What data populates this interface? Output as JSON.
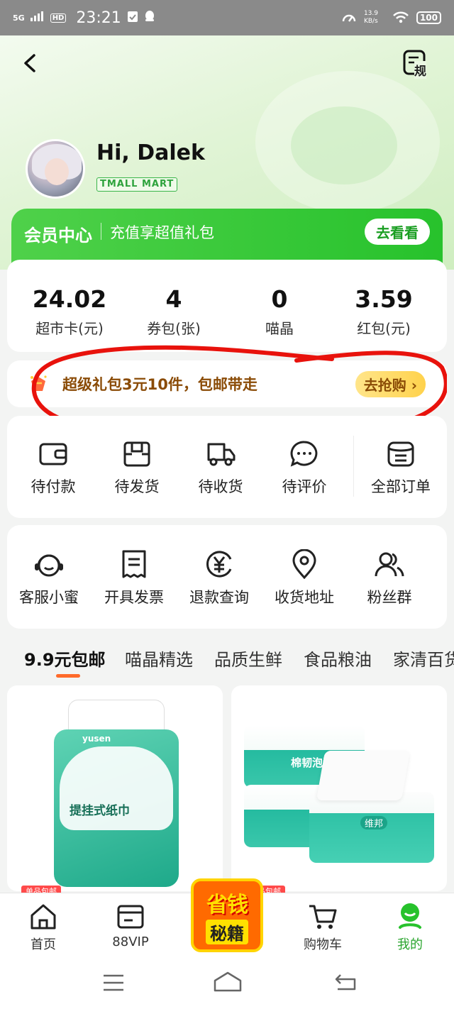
{
  "status_bar": {
    "network": "5G",
    "hd": "HD",
    "time": "23:21",
    "speed": "13.9 KB/s",
    "battery": "100"
  },
  "header": {
    "back_icon": "chevron-left-icon",
    "rules_label": "规"
  },
  "profile": {
    "greeting": "Hi, Dalek",
    "badge": "TMALL MART"
  },
  "member": {
    "title": "会员中心",
    "subtitle": "充值享超值礼包",
    "button": "去看看"
  },
  "stats": [
    {
      "value": "24.02",
      "label": "超市卡(元)"
    },
    {
      "value": "4",
      "label": "券包(张)"
    },
    {
      "value": "0",
      "label": "喵晶"
    },
    {
      "value": "3.59",
      "label": "红包(元)"
    }
  ],
  "promo": {
    "title": "超级礼包3元10件，包邮带走",
    "button": "去抢购 ›"
  },
  "orders": [
    {
      "label": "待付款",
      "icon": "wallet-icon"
    },
    {
      "label": "待发货",
      "icon": "package-icon"
    },
    {
      "label": "待收货",
      "icon": "truck-icon"
    },
    {
      "label": "待评价",
      "icon": "chat-bubble-icon"
    },
    {
      "label": "全部订单",
      "icon": "orders-list-icon"
    }
  ],
  "services": [
    {
      "label": "客服小蜜",
      "icon": "headset-icon"
    },
    {
      "label": "开具发票",
      "icon": "invoice-icon"
    },
    {
      "label": "退款查询",
      "icon": "refund-yen-icon"
    },
    {
      "label": "收货地址",
      "icon": "location-pin-icon"
    },
    {
      "label": "粉丝群",
      "icon": "group-icon"
    }
  ],
  "tabs": [
    "9.9元包邮",
    "喵晶精选",
    "品质生鲜",
    "食品粮油",
    "家清百货"
  ],
  "products": [
    {
      "tag": "单品包邮",
      "pack_text": "提挂式纸巾",
      "brand": "yusen"
    },
    {
      "tag": "单品包邮",
      "pack_text": "棉韧泡泡纸",
      "brand": "维邦"
    }
  ],
  "bottom_nav": [
    {
      "label": "首页",
      "icon": "home-icon"
    },
    {
      "label": "88VIP",
      "icon": "vip-card-icon"
    },
    {
      "label": "购物车",
      "icon": "cart-icon"
    },
    {
      "label": "我的",
      "icon": "my-profile-icon"
    }
  ],
  "center_promo": {
    "line1": "省钱",
    "line2": "秘籍"
  },
  "colors": {
    "brand_green": "#27c22c",
    "accent_orange": "#ff6a2a",
    "promo_brown": "#8a4b06",
    "annotation_red": "#e8120c"
  }
}
